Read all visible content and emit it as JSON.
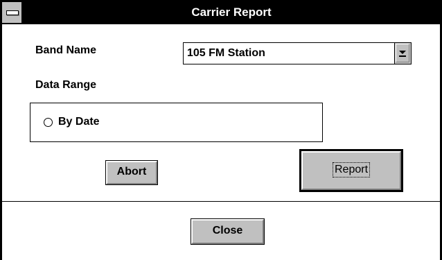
{
  "window": {
    "title": "Carrier Report"
  },
  "form": {
    "band_name_label": "Band Name",
    "band_name_value": "105 FM Station",
    "data_range_label": "Data Range",
    "radio_by_date_label": "By Date",
    "radio_by_date_checked": false
  },
  "buttons": {
    "abort_label": "Abort",
    "report_label": "Report",
    "close_label": "Close"
  },
  "icons": {
    "system_menu": "system-menu-icon",
    "dropdown": "dropdown-arrow-icon",
    "radio": "radio-unchecked-icon"
  }
}
